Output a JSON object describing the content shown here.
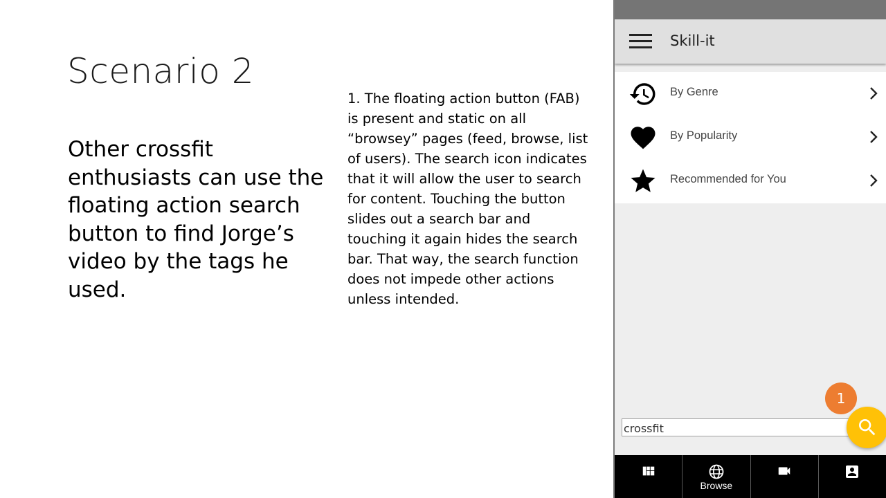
{
  "slide": {
    "title": "Scenario 2",
    "body": "Other crossfit enthusiasts  can use the floating action search button to find Jorge’s video by the tags he used.",
    "notes": "1. The floating action button (FAB) is present and static on all “browsey” pages (feed, browse, list of users). The search icon indicates that it will allow the user to search for content. Touching the button slides out a search bar and touching it again hides the search bar. That way, the search function does not impede other actions unless intended."
  },
  "app": {
    "title": "Skill-it",
    "menu": [
      {
        "label": "By Genre",
        "icon": "history-icon"
      },
      {
        "label": "By Popularity",
        "icon": "heart-icon"
      },
      {
        "label": "Recommended for You",
        "icon": "star-icon"
      }
    ],
    "search": {
      "value": "crossfit"
    },
    "fab_icon": "search-icon",
    "bottom_nav": [
      {
        "label": "",
        "icon": "dashboard-icon"
      },
      {
        "label": "Browse",
        "icon": "globe-icon"
      },
      {
        "label": "",
        "icon": "video-camera-icon"
      },
      {
        "label": "",
        "icon": "account-box-icon"
      }
    ]
  },
  "callout": {
    "number": "1"
  },
  "colors": {
    "fab": "#ffc107",
    "callout": "#ed7d31",
    "bottom_nav": "#000000",
    "app_bar": "#e0e0e0",
    "status_bar": "#757575"
  }
}
